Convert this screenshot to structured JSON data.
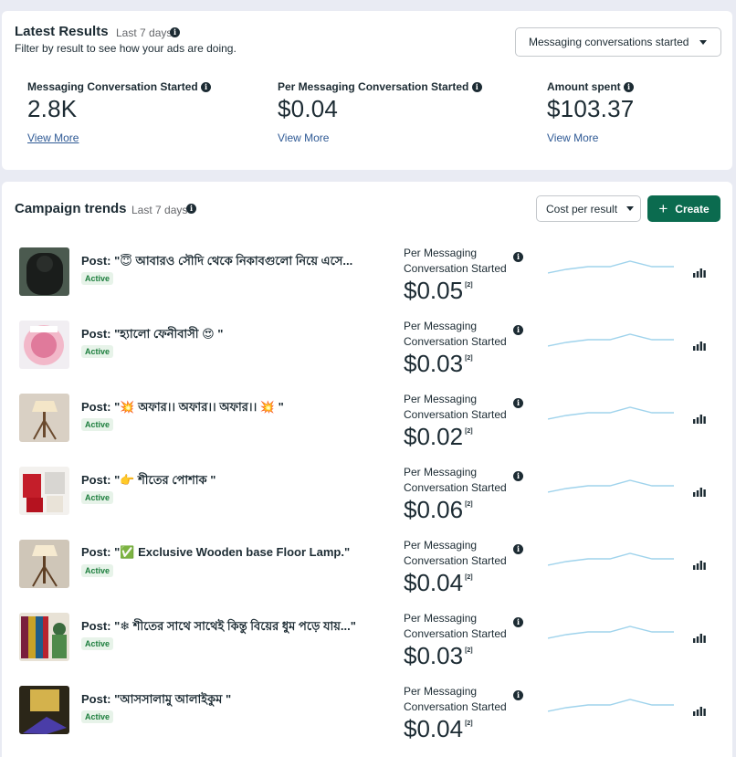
{
  "latest_results": {
    "title": "Latest Results",
    "range": "Last 7 days",
    "subtitle": "Filter by result to see how your ads are doing.",
    "filter": "Messaging conversations started",
    "metrics": [
      {
        "label": "Messaging Conversation Started",
        "value": "2.8K",
        "link": "View More"
      },
      {
        "label": "Per Messaging Conversation Started",
        "value": "$0.04",
        "link": "View More"
      },
      {
        "label": "Amount spent",
        "value": "$103.37",
        "link": "View More"
      }
    ]
  },
  "campaign_trends": {
    "title": "Campaign trends",
    "range": "Last 7 days",
    "sort": "Cost per result",
    "create": "Create",
    "colors": {
      "accent": "#0b6b4f",
      "sparkline": "#9fd3ec",
      "badge_bg": "#e7f3e9",
      "badge_text": "#1b7d3c"
    },
    "rows": [
      {
        "name": "Post: \"😇 আবারও সৌদি থেকে নিকাবগুলো নিয়ে এসে...",
        "status": "Active",
        "metric_label": "Per Messaging Conversation Started",
        "value": "$0.05",
        "note": "[2]"
      },
      {
        "name": "Post: \"হ্যালো ফেনীবাসী 😍 \"",
        "status": "Active",
        "metric_label": "Per Messaging Conversation Started",
        "value": "$0.03",
        "note": "[2]"
      },
      {
        "name": "Post: \"💥 অফার।। অফার।। অফার।। 💥 \"",
        "status": "Active",
        "metric_label": "Per Messaging Conversation Started",
        "value": "$0.02",
        "note": "[2]"
      },
      {
        "name": "Post: \"👉 শীতের পোশাক \"",
        "status": "Active",
        "metric_label": "Per Messaging Conversation Started",
        "value": "$0.06",
        "note": "[2]"
      },
      {
        "name": "Post: \"✅ Exclusive Wooden base Floor Lamp.\"",
        "status": "Active",
        "metric_label": "Per Messaging Conversation Started",
        "value": "$0.04",
        "note": "[2]"
      },
      {
        "name": "Post: \"❄ শীতের সাথে সাথেই কিন্তু বিয়ের ধুম পড়ে যায়...\"",
        "status": "Active",
        "metric_label": "Per Messaging Conversation Started",
        "value": "$0.03",
        "note": "[2]"
      },
      {
        "name": "Post: \"আসসালামু আলাইকুম \"",
        "status": "Active",
        "metric_label": "Per Messaging Conversation Started",
        "value": "$0.04",
        "note": "[2]"
      }
    ]
  }
}
